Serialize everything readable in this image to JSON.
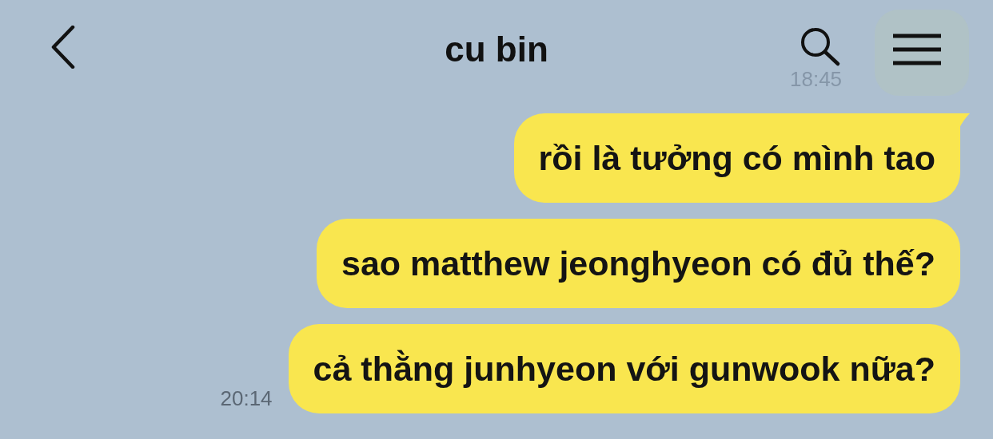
{
  "header": {
    "title": "cu bin",
    "ghost_time": "18:45"
  },
  "messages": [
    {
      "text": "rồi là tưởng có mình tao",
      "tail": true
    },
    {
      "text": "sao matthew jeonghyeon có đủ thế?",
      "tail": false
    },
    {
      "text": "cả thằng junhyeon với gunwook nữa?",
      "tail": false,
      "time": "20:14"
    }
  ]
}
